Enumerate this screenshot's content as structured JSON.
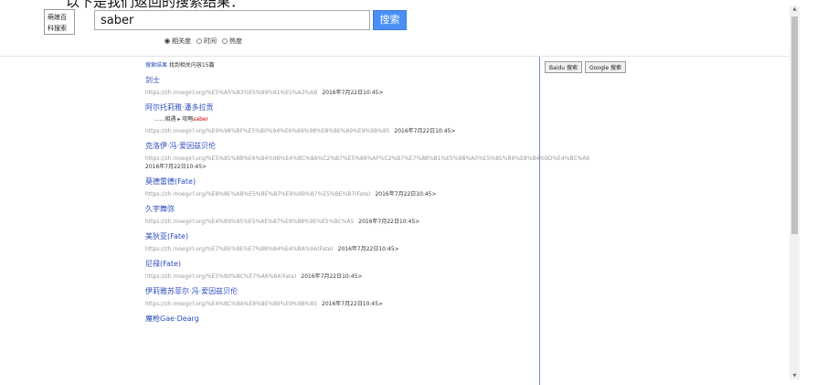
{
  "caption_top": "以下是我们返回的搜索结果：",
  "logo": {
    "line1": "萌娘百",
    "line2": "科搜索"
  },
  "search": {
    "query": "saber",
    "button": "搜索"
  },
  "sort_options": [
    {
      "label": "相关度",
      "checked": true
    },
    {
      "label": "时间",
      "checked": false
    },
    {
      "label": "热度",
      "checked": false
    }
  ],
  "summary": {
    "label": "搜索结果",
    "text": " 找到相关内容15篇"
  },
  "external_buttons": [
    "Baidu 搜索",
    "Google 搜索"
  ],
  "results": [
    {
      "title": "剑士",
      "url": "https://zh.moegirl.org/%E5%A5%B3%E5%89%91%E5%A3%AB",
      "date": "2016年7月22日10:45>"
    },
    {
      "title": "阿尔托莉雅·潘多拉贡",
      "snippet_pre": "......相遇 ▸ 攻略",
      "snippet_hl": "saber",
      "url": "https://zh.moegirl.org/%E9%98%BF%E5%B0%94%E6%89%98%E8%8E%89%E9%9B%85",
      "date": "2016年7月22日10:45>"
    },
    {
      "title": "克洛伊·冯·爱因兹贝伦",
      "url": "https://zh.moegirl.org/%E5%85%8B%E6%B4%9B%E4%BC%8A%C2%B7%E5%86%AF%C2%B7%E7%88%B1%E5%9B%A0%E5%85%B9%E8%B4%9D%E4%BC%A6",
      "date": "2016年7月22日10:45>",
      "date_newline": true
    },
    {
      "title": "莫德雷德(Fate)",
      "url": "https://zh.moegirl.org/%E8%8E%AB%E5%BE%B7%E9%9B%B7%E5%BE%B7(Fate)",
      "date": "2016年7月22日10:45>"
    },
    {
      "title": "久宇舞弥",
      "url": "https://zh.moegirl.org/%E4%B9%85%E5%AE%87%E8%88%9E%E5%BC%A5",
      "date": "2016年7月22日10:45>"
    },
    {
      "title": "美狄亚(Fate)",
      "url": "https://zh.moegirl.org/%E7%BE%8E%E7%8B%84%E4%BA%9A(Fate)",
      "date": "2016年7月22日10:45>"
    },
    {
      "title": "尼禄(Fate)",
      "url": "https://zh.moegirl.org/%E5%B0%BC%E7%A6%84(Fate)",
      "date": "2016年7月22日10:45>"
    },
    {
      "title": "伊莉雅苏菲尔·冯·爱因兹贝伦",
      "url": "https://zh.moegirl.org/%E4%BC%8A%E8%8E%89%E9%9B%85",
      "date": "2016年7月22日10:45>"
    },
    {
      "title": "魔枪Gae·Dearg"
    }
  ]
}
